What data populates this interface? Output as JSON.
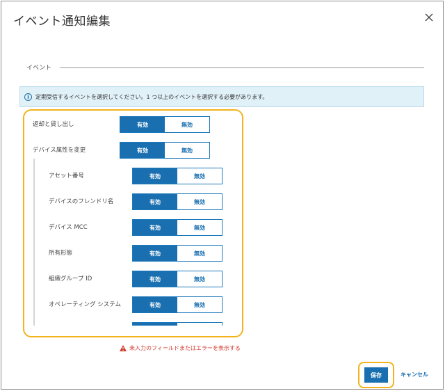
{
  "dialog": {
    "title": "イベント通知編集",
    "close_icon": "close-icon"
  },
  "section": {
    "legend": "イベント"
  },
  "info": {
    "icon": "info-icon",
    "text": "定期受信するイベントを選択してください。1 つ以上のイベントを選択する必要があります。"
  },
  "toggle_labels": {
    "on": "有効",
    "off": "無効"
  },
  "events": [
    {
      "label": "返却と貸し出し",
      "state": "有効"
    },
    {
      "label": "デバイス属性を変更",
      "state": "有効"
    }
  ],
  "sub_events": [
    {
      "label": "アセット番号",
      "state": "有効"
    },
    {
      "label": "デバイスのフレンドリ名",
      "state": "有効"
    },
    {
      "label": "デバイス MCC",
      "state": "有効"
    },
    {
      "label": "所有形態",
      "state": "有効"
    },
    {
      "label": "組織グループ ID",
      "state": "有効"
    },
    {
      "label": "オペレーティング システム",
      "state": "有効"
    },
    {
      "label": "",
      "state": "有効"
    }
  ],
  "error": {
    "icon": "warning-icon",
    "text": "未入力のフィールドまたはエラーを表示する"
  },
  "footer": {
    "save_label": "保存",
    "cancel_label": "キャンセル"
  },
  "colors": {
    "primary": "#1a6fb0",
    "highlight": "#f2b31d",
    "error": "#d23a2e",
    "info_bg": "#e1f1f8"
  }
}
